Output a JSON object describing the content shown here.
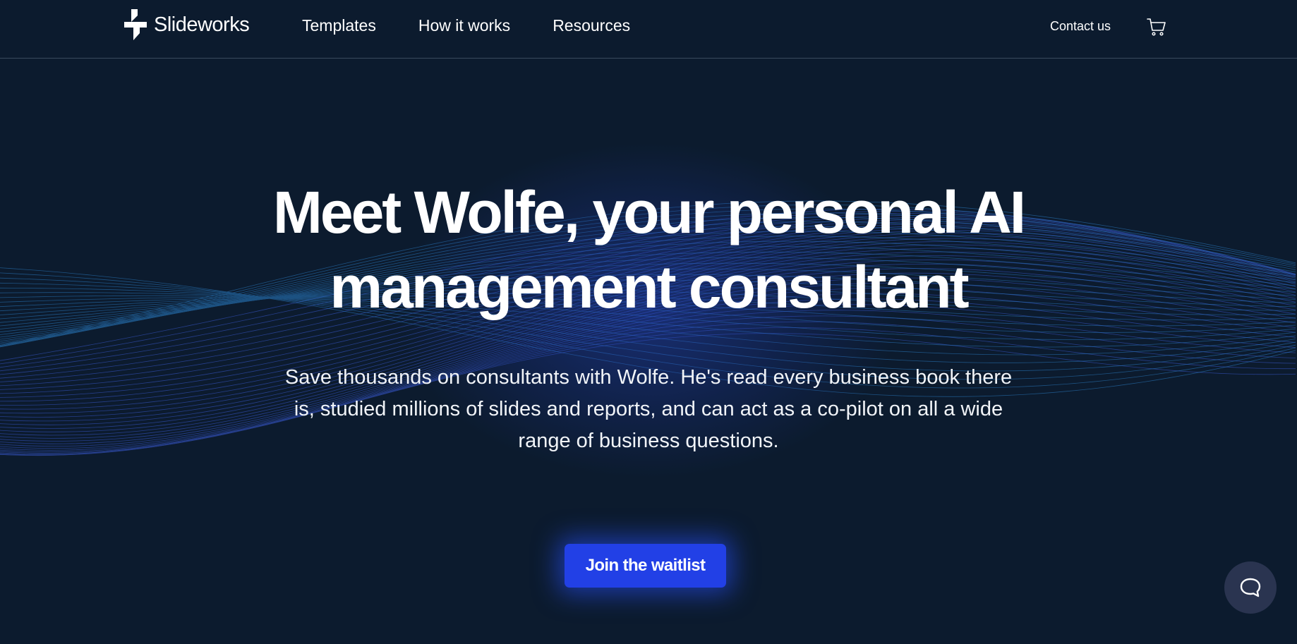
{
  "brand": {
    "name": "Slideworks"
  },
  "nav": {
    "items": [
      {
        "label": "Templates"
      },
      {
        "label": "How it works"
      },
      {
        "label": "Resources"
      }
    ],
    "contact_label": "Contact us"
  },
  "hero": {
    "title_line1": "Meet Wolfe, your personal AI",
    "title_line2": "management consultant",
    "subtitle": "Save thousands on consultants with Wolfe. He's read every business book there is, studied millions of slides and reports, and can act as a co-pilot on all a wide range of business questions.",
    "cta_label": "Join the waitlist"
  },
  "colors": {
    "background": "#0c1b2e",
    "accent": "#2240e6",
    "wave_blue": "#3b5bd6",
    "wave_cyan": "#2b7fc8"
  },
  "icons": {
    "logo": "slideworks-logo-icon",
    "cart": "shopping-cart-icon",
    "chat": "chat-bubble-icon"
  }
}
